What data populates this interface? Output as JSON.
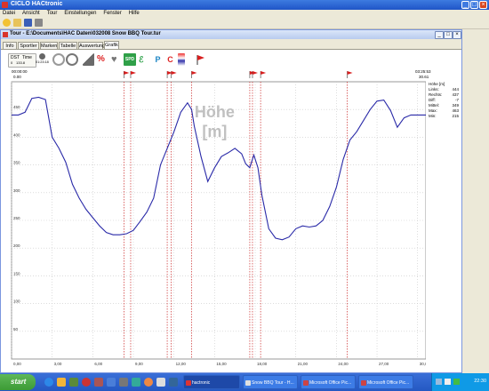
{
  "app": {
    "title": "CICLO HACtronic"
  },
  "menu": [
    "Datei",
    "Ansicht",
    "Tour",
    "Einstellungen",
    "Fenster",
    "Hilfe"
  ],
  "inner": {
    "title": "Tour - E:\\Documents\\HAC Daten\\032008 Snow BBQ Tour.tur"
  },
  "tabs": [
    "Info",
    "Sportler",
    "Marken",
    "Tabelle",
    "Auswertung",
    "Grafik"
  ],
  "active_tab": "Grafik",
  "graph_toolbar": {
    "dst_label": "DST",
    "time_label": "Time",
    "dst_value": "133.8",
    "dst_check": "0",
    "time_value": "01:23:18",
    "speed_label": "SPD",
    "power_label": "P",
    "cadence_label": "C"
  },
  "header": {
    "left_time_top": "00:00:00",
    "left_value_bottom": "0.00",
    "right_time_top": "03:25:53",
    "right_value_bottom": "30.61"
  },
  "watermark": {
    "line1": "Höhe",
    "line2": "[m]"
  },
  "stats": {
    "heading": "Höhe [m]",
    "rows": [
      {
        "label": "Links:",
        "value": "444"
      },
      {
        "label": "Rechts:",
        "value": "437"
      },
      {
        "label": "Diff:",
        "value": "-7"
      },
      {
        "label": "Mittel:",
        "value": "349"
      },
      {
        "label": "Max:",
        "value": "463"
      },
      {
        "label": "Min:",
        "value": "215"
      }
    ]
  },
  "colors": {
    "line": "#2a2aa8",
    "marker": "#cc2a2a",
    "flag": "#d81e1e"
  },
  "chart_data": {
    "type": "line",
    "ylim": [
      0,
      500
    ],
    "yticks": [
      "450",
      "400",
      "350",
      "300",
      "250",
      "200",
      "150",
      "100",
      "50"
    ],
    "xticks": [
      "0,00",
      "3,00",
      "6,00",
      "9,00",
      "12,00",
      "15,00",
      "18,00",
      "21,00",
      "24,00",
      "27,00",
      "30,00"
    ],
    "xlim": [
      0,
      30.61
    ],
    "markers_km": [
      8.3,
      8.8,
      11.5,
      11.8,
      13.3,
      17.6,
      17.8,
      18.4,
      24.8
    ],
    "series": [
      {
        "x": [
          0,
          0.5,
          1,
          1.5,
          2,
          2.5,
          3,
          3.5,
          4,
          4.5,
          5,
          5.5,
          6,
          6.5,
          7,
          7.5,
          8,
          8.5,
          9,
          9.5,
          10,
          10.5,
          11,
          11.5,
          12,
          12.5,
          13,
          13.3,
          13.5,
          14,
          14.5,
          15,
          15.5,
          16,
          16.5,
          17,
          17.3,
          17.6,
          17.9,
          18.2,
          18.5,
          19,
          19.5,
          20,
          20.5,
          21,
          21.5,
          22,
          22.5,
          23,
          23.5,
          24,
          24.5,
          25,
          25.5,
          26,
          26.5,
          27,
          27.5,
          28,
          28.5,
          29,
          29.5,
          30,
          30.61
        ],
        "y": [
          440,
          440,
          445,
          470,
          472,
          468,
          400,
          380,
          355,
          315,
          290,
          270,
          255,
          240,
          228,
          224,
          224,
          226,
          232,
          248,
          265,
          290,
          350,
          380,
          410,
          445,
          462,
          450,
          420,
          365,
          320,
          345,
          365,
          372,
          380,
          370,
          352,
          345,
          368,
          345,
          295,
          235,
          218,
          215,
          220,
          235,
          240,
          238,
          240,
          250,
          275,
          310,
          360,
          395,
          410,
          430,
          450,
          465,
          467,
          448,
          418,
          435,
          440,
          440,
          440
        ]
      }
    ]
  },
  "taskbar": {
    "start": "start",
    "tasks": [
      "hactronic",
      "Snow BBQ Tour - H...",
      "Microsoft Office Pic...",
      "Microsoft Office Pic..."
    ],
    "clock": "22:30"
  }
}
